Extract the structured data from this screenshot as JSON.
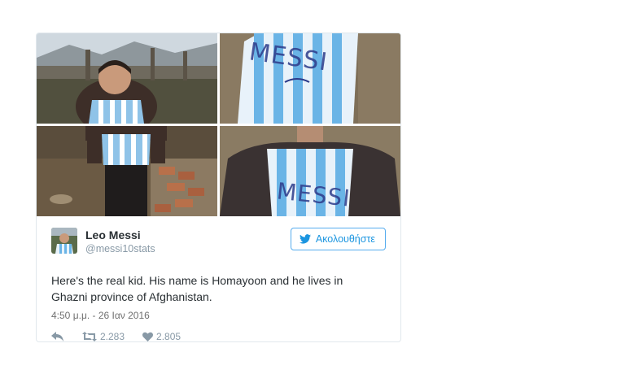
{
  "tweet": {
    "author": {
      "name": "Leo Messi",
      "handle": "@messi10stats"
    },
    "follow_label": "Ακολουθήστε",
    "text": "Here's the real kid. His name is Homayoon and he lives in Ghazni province of Afghanistan.",
    "timestamp": "4:50 μ.μ. - 26 Ιαν 2016",
    "actions": {
      "reply_icon": "reply-icon",
      "retweet_count": "2.283",
      "like_count": "2.805"
    },
    "photos": {
      "shirt_text": "MESSI"
    }
  },
  "colors": {
    "accent": "#1b95e0",
    "stripe_blue": "#6ab4e6",
    "text": "#292f33",
    "muted": "#8899a6"
  }
}
